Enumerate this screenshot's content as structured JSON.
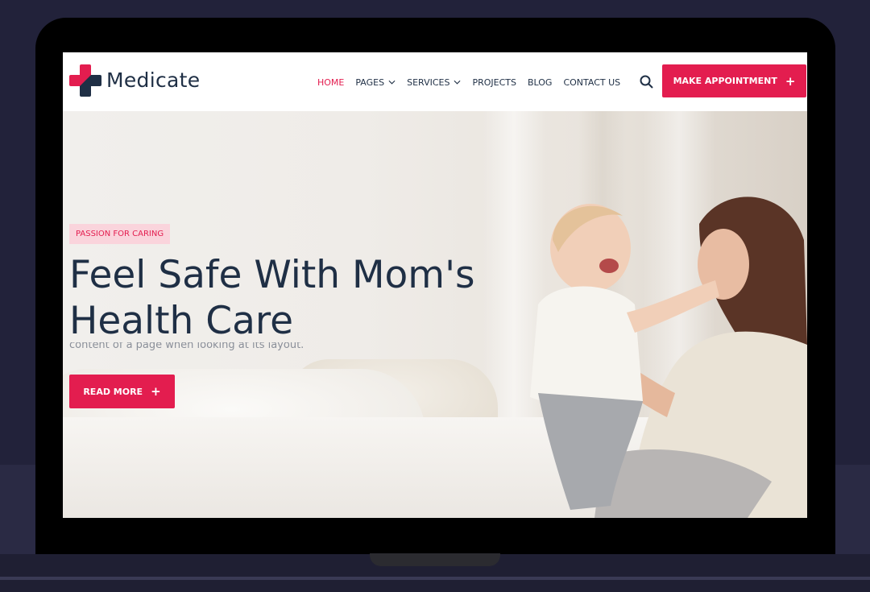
{
  "colors": {
    "accent": "#e31d4f",
    "navy": "#1f2f45",
    "badge_bg": "#fad4dc",
    "backdrop": "#22223a",
    "device": "#000000"
  },
  "site": {
    "brand": "Medicate",
    "logo_icon": "medical-cross-icon"
  },
  "nav": {
    "items": [
      {
        "label": "HOME",
        "active": true,
        "dropdown": false
      },
      {
        "label": "PAGES",
        "active": false,
        "dropdown": true
      },
      {
        "label": "SERVICES",
        "active": false,
        "dropdown": true
      },
      {
        "label": "PROJECTS",
        "active": false,
        "dropdown": false
      },
      {
        "label": "BLOG",
        "active": false,
        "dropdown": false
      },
      {
        "label": "CONTACT US",
        "active": false,
        "dropdown": false
      }
    ],
    "search_icon": "search-icon",
    "cta_label": "MAKE APPOINTMENT",
    "cta_icon": "plus-icon"
  },
  "hero": {
    "badge": "PASSION FOR CARING",
    "title": "Feel Safe With Mom's Health Care",
    "snippet": "content of a page when looking at its layout.",
    "button_label": "READ MORE",
    "button_icon": "plus-icon"
  }
}
